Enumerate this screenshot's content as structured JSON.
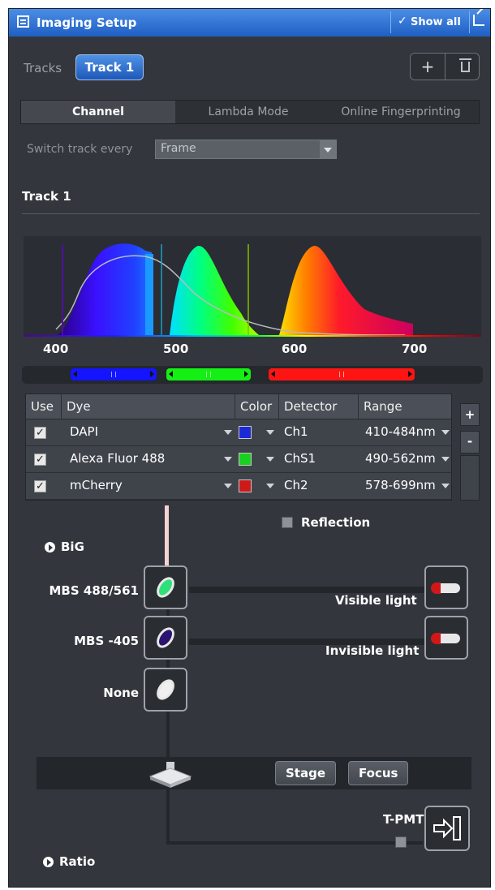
{
  "title": "Imaging Setup",
  "show_all": "Show all",
  "tracks_label": "Tracks",
  "track_button": "Track 1",
  "tabs": [
    "Channel",
    "Lambda Mode",
    "Online Fingerprinting"
  ],
  "switch_track_label": "Switch track every",
  "switch_track_value": "Frame",
  "track_heading": "Track 1",
  "wavelength_ticks": [
    "400",
    "500",
    "600",
    "700"
  ],
  "table": {
    "headers": {
      "use": "Use",
      "dye": "Dye",
      "color": "Color",
      "detector": "Detector",
      "range": "Range"
    },
    "rows": [
      {
        "dye": "DAPI",
        "color": "#1a2ad8",
        "detector": "Ch1",
        "range": "410-484nm"
      },
      {
        "dye": "Alexa Fluor 488",
        "color": "#18d020",
        "detector": "ChS1",
        "range": "490-562nm"
      },
      {
        "dye": "mCherry",
        "color": "#cc1a1a",
        "detector": "Ch2",
        "range": "578-699nm"
      }
    ],
    "add": "+",
    "remove": "-"
  },
  "reflection_label": "Reflection",
  "big_label": "BiG",
  "beam_path": {
    "mbs1": "MBS 488/561",
    "mbs2": "MBS -405",
    "mbs3": "None",
    "visible_light": "Visible light",
    "invisible_light": "Invisible light"
  },
  "stage_button": "Stage",
  "focus_button": "Focus",
  "tpmt_label": "T-PMT",
  "ratio_label": "Ratio",
  "colors": {
    "title_bar": "#2f74d8",
    "accent": "#3a82e2",
    "panel": "#33373d"
  }
}
